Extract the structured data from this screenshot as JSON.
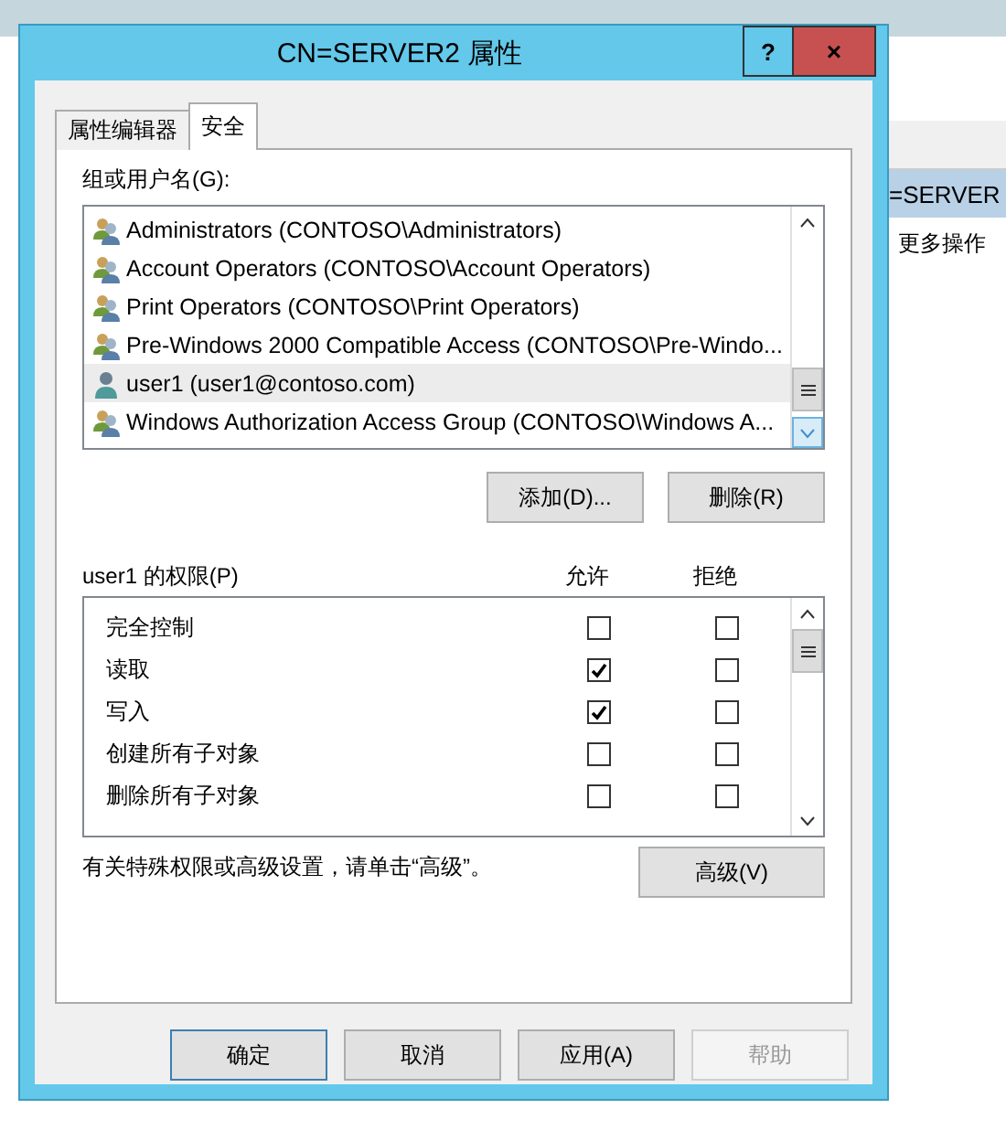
{
  "background_window": {
    "actions_header": "=SERVER",
    "actions_item": "更多操作"
  },
  "dialog": {
    "title": "CN=SERVER2 属性",
    "help": "?",
    "close": "×"
  },
  "tabs": [
    {
      "label": "属性编辑器",
      "selected": false
    },
    {
      "label": "安全",
      "selected": true
    }
  ],
  "groups_label": "组或用户名(G):",
  "groups": [
    {
      "name": "Administrators (CONTOSO\\Administrators)",
      "kind": "group",
      "selected": false
    },
    {
      "name": "Account Operators (CONTOSO\\Account Operators)",
      "kind": "group",
      "selected": false
    },
    {
      "name": "Print Operators (CONTOSO\\Print Operators)",
      "kind": "group",
      "selected": false
    },
    {
      "name": "Pre-Windows 2000 Compatible Access (CONTOSO\\Pre-Windo...",
      "kind": "group",
      "selected": false
    },
    {
      "name": "user1 (user1@contoso.com)",
      "kind": "user",
      "selected": true
    },
    {
      "name": "Windows Authorization Access Group (CONTOSO\\Windows A...",
      "kind": "group",
      "selected": false
    }
  ],
  "group_buttons": [
    "添加(D)...",
    "删除(R)"
  ],
  "permissions_label": "user1 的权限(P)",
  "allow_header": "允许",
  "deny_header": "拒绝",
  "permissions": [
    {
      "name": "完全控制",
      "allow": false,
      "deny": false
    },
    {
      "name": "读取",
      "allow": true,
      "deny": false
    },
    {
      "name": "写入",
      "allow": true,
      "deny": false
    },
    {
      "name": "创建所有子对象",
      "allow": false,
      "deny": false
    },
    {
      "name": "删除所有子对象",
      "allow": false,
      "deny": false
    }
  ],
  "advanced_note": "有关特殊权限或高级设置，请单击“高级”。",
  "advanced_button": "高级(V)",
  "buttons": [
    {
      "label": "确定",
      "disabled": false
    },
    {
      "label": "取消",
      "disabled": false
    },
    {
      "label": "应用(A)",
      "disabled": false
    },
    {
      "label": "帮助",
      "disabled": true
    }
  ]
}
